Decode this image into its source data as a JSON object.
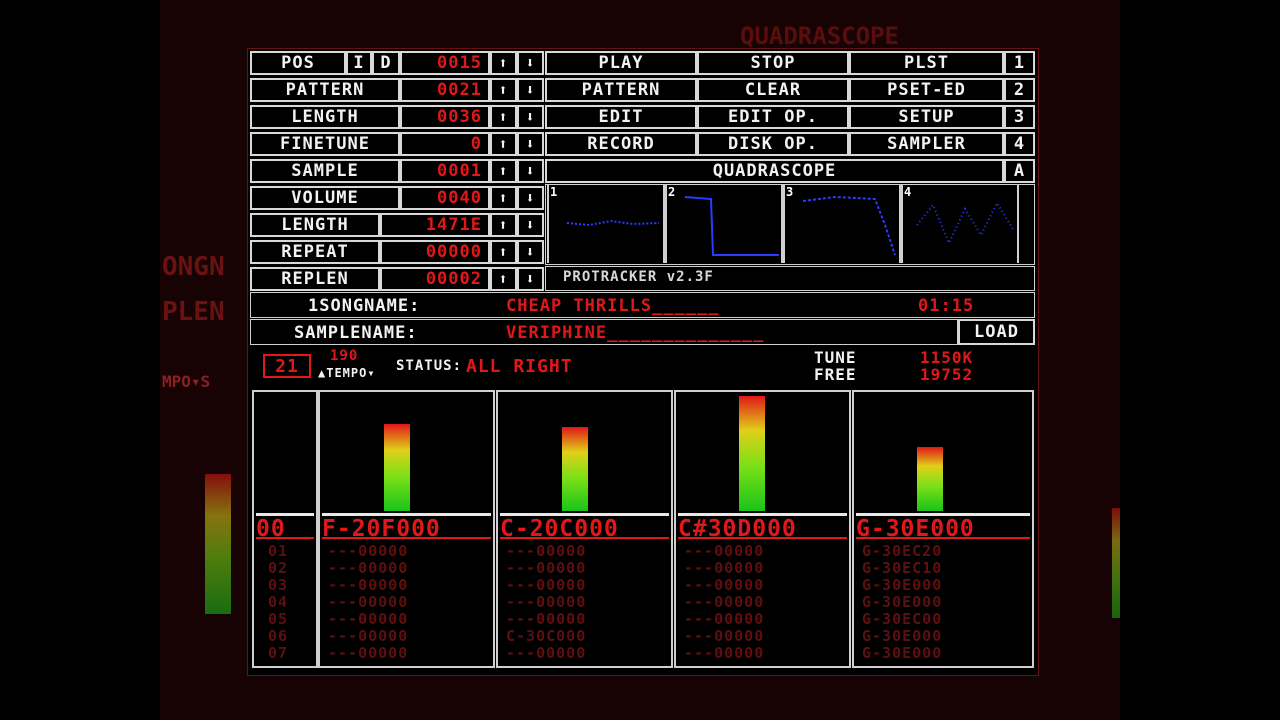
{
  "background_ghost": {
    "top_label": "QUADRASCOPE",
    "left_text_1": "ONGN",
    "left_text_2": "PLEN",
    "left_tempo": "MPO▾S"
  },
  "controls": {
    "pos": {
      "label": "POS",
      "i": "I",
      "d": "D",
      "value": "0015"
    },
    "pattern": {
      "label": "PATTERN",
      "value": "0021"
    },
    "length": {
      "label": "LENGTH",
      "value": "0036"
    },
    "finetune": {
      "label": "FINETUNE",
      "value": "0"
    },
    "sample": {
      "label": "SAMPLE",
      "value": "0001"
    },
    "volume": {
      "label": "VOLUME",
      "value": "0040"
    },
    "sample_length": {
      "label": "LENGTH",
      "value": "1471E"
    },
    "repeat": {
      "label": "REPEAT",
      "value": "00000"
    },
    "replen": {
      "label": "REPLEN",
      "value": "00002"
    },
    "up_arrow": "⬆",
    "down_arrow": "⬇"
  },
  "buttons": {
    "play": "PLAY",
    "stop": "STOP",
    "plst": "PLST",
    "n1": "1",
    "pattern": "PATTERN",
    "clear": "CLEAR",
    "pset_ed": "PSET-ED",
    "n2": "2",
    "edit": "EDIT",
    "edit_op": "EDIT OP.",
    "setup": "SETUP",
    "n3": "3",
    "record": "RECORD",
    "disk_op": "DISK OP.",
    "sampler": "SAMPLER",
    "n4": "4",
    "quadrascope": "QUADRASCOPE",
    "a": "A"
  },
  "scopes": {
    "labels": [
      "1",
      "2",
      "3",
      "4"
    ],
    "version": "PROTRACKER v2.3F"
  },
  "song": {
    "songname_label": "1SONGNAME:",
    "songname": "CHEAP THRILLS______",
    "time": "01:15",
    "samplename_label": "SAMPLENAME:",
    "samplename": "VERIPHINE______________",
    "load": "LOAD"
  },
  "status": {
    "speed": "21",
    "tempo_value": "190",
    "tempo_label": "▲TEMPO▾",
    "status_label": "STATUS:",
    "status_text": "ALL RIGHT",
    "tune_label": "TUNE",
    "tune_value": "1150K",
    "free_label": "FREE",
    "free_value": "19752"
  },
  "pattern": {
    "current_row": "00",
    "row_numbers": "01\n02\n03\n04\n05\n06\n07",
    "channels": [
      {
        "current": "F-20F000",
        "rows": "---00000\n---00000\n---00000\n---00000\n---00000\n---00000\n---00000",
        "vu": 0.31
      },
      {
        "current": "C-20C000",
        "rows": "---00000\n---00000\n---00000\n---00000\n---00000\nC-30C000\n---00000",
        "vu": 0.3
      },
      {
        "current": "C#30D000",
        "rows": "---00000\n---00000\n---00000\n---00000\n---00000\n---00000\n---00000",
        "vu": 0.41
      },
      {
        "current": "G-30E000",
        "rows": "G-30EC20\nG-30EC10\nG-30E000\nG-30E000\nG-30EC00\nG-30E000\nG-30E000",
        "vu": 0.23
      }
    ]
  }
}
